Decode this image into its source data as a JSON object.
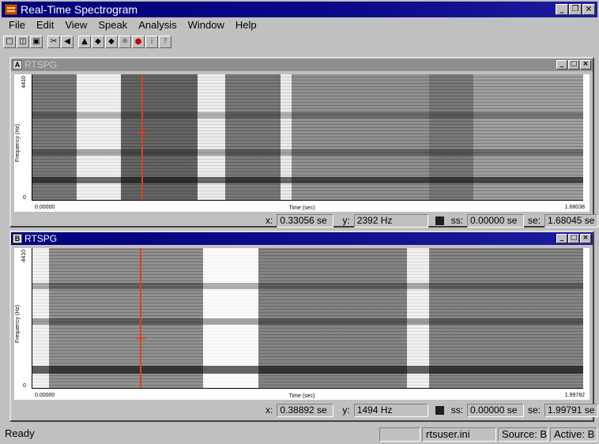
{
  "app": {
    "title": "Real-Time Spectrogram",
    "window_buttons": [
      "_",
      "❐",
      "×"
    ]
  },
  "menu": [
    "File",
    "Edit",
    "View",
    "Speak",
    "Analysis",
    "Window",
    "Help"
  ],
  "toolbar": {
    "icons": [
      "new-icon",
      "open-icon",
      "save-icon",
      "cut-icon",
      "rewind-icon",
      "eraser-icon",
      "prev-icon",
      "next-icon",
      "gear-icon",
      "record-icon",
      "info-icon",
      "help-icon"
    ]
  },
  "windows": [
    {
      "letter": "A",
      "name": "RTSPG",
      "active": false,
      "y_top": "4410",
      "y_bot": "0",
      "y_label": "Frequency (Hz)",
      "x_start": "0.00000",
      "x_end": "1.68038",
      "x_label": "Time (sec)",
      "readout": {
        "x_label": "x:",
        "x_value": "0.33056 se",
        "y_label": "y:",
        "y_value": "2392 Hz",
        "ss_label": "ss:",
        "ss_value": "0.00000 se",
        "se_label": "se:",
        "se_value": "1.68045 se"
      }
    },
    {
      "letter": "B",
      "name": "RTSPG",
      "active": true,
      "y_top": "4410",
      "y_bot": "0",
      "y_label": "Frequency (Hz)",
      "x_start": "0.00000",
      "x_end": "1.99782",
      "x_label": "Time (sec)",
      "readout": {
        "x_label": "x:",
        "x_value": "0.38892 se",
        "y_label": "y:",
        "y_value": "1494 Hz",
        "ss_label": "ss:",
        "ss_value": "0.00000 se",
        "se_label": "se:",
        "se_value": "1.99791 se"
      }
    }
  ],
  "status": {
    "ready": "Ready",
    "ini": "rtsuser.ini",
    "source": "Source: B",
    "active": "Active: B"
  },
  "colors": {
    "title_active": "#00007b",
    "title_inactive": "#8e8e8e",
    "cursor": "#e04020",
    "chrome": "#c0c0c0"
  }
}
